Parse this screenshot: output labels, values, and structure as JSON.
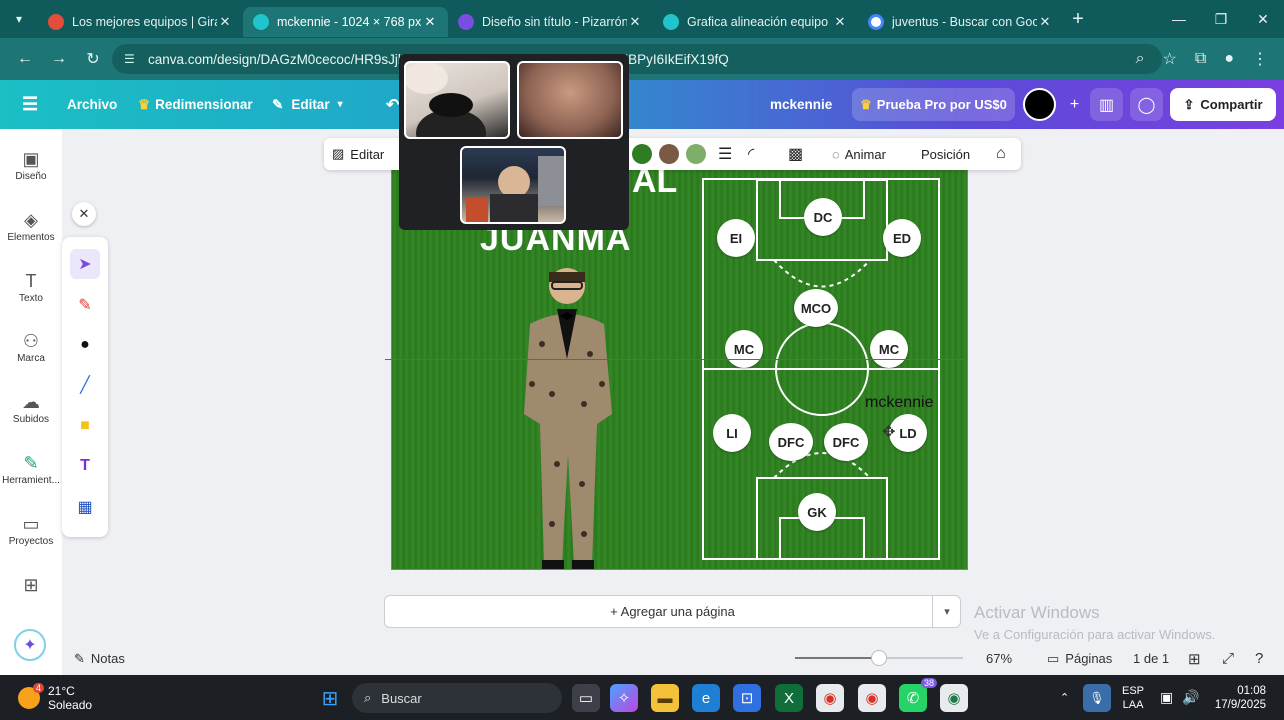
{
  "browser": {
    "tabs": [
      {
        "title": "Los mejores equipos | Gira la",
        "color": "#e44d3a"
      },
      {
        "title": "mckennie - 1024 × 768 px",
        "color": "#20c4cb"
      },
      {
        "title": "Diseño sin título - Pizarrón",
        "color": "#7a4ce0"
      },
      {
        "title": "Grafica alineación equipo de",
        "color": "#20c4cb"
      },
      {
        "title": "juventus - Buscar con Googl",
        "color": "#4285f4"
      }
    ],
    "new_tab": "+",
    "url": "canva.com/design/DAGzM0cecoc/HR9sJjlZo…nsiRCl6eyJBPyI6IkEifSwiQiI6eyJBPyI6IkEifX19fQ"
  },
  "canva_header": {
    "menu": [
      "Archivo",
      "Redimensionar",
      "Editar"
    ],
    "doc_name": "mckennie",
    "pro_button": "Prueba Pro por US$0",
    "share": "Compartir"
  },
  "sidenav": {
    "items": [
      {
        "label": "Diseño",
        "icon": "layout-icon"
      },
      {
        "label": "Elementos",
        "icon": "shapes-icon"
      },
      {
        "label": "Texto",
        "icon": "text-icon"
      },
      {
        "label": "Marca",
        "icon": "brand-icon"
      },
      {
        "label": "Subidos",
        "icon": "upload-icon"
      },
      {
        "label": "Herramient...",
        "icon": "tools-icon"
      },
      {
        "label": "Proyectos",
        "icon": "folder-icon"
      }
    ]
  },
  "element_toolbar": {
    "edit": "Editar",
    "animate": "Animar",
    "position": "Posición",
    "swatches": [
      "#2f7d22",
      "#7a5a45",
      "#7fae6a"
    ]
  },
  "design": {
    "title_line1": "AL",
    "title_line2": "JUANMA",
    "floating_text": "mckennie",
    "positions": [
      "DC",
      "EI",
      "ED",
      "MCO",
      "MC",
      "MC",
      "LI",
      "DFC",
      "DFC",
      "LD",
      "GK"
    ]
  },
  "add_page": "+ Agregar una página",
  "activate_windows": {
    "title": "Activar Windows",
    "subtitle": "Ve a Configuración para activar Windows."
  },
  "bottom_bar": {
    "notes": "Notas",
    "zoom": "67%",
    "zoom_fraction": 0.5,
    "pages_label": "Páginas",
    "page_counter": "1 de 1"
  },
  "taskbar": {
    "weather_temp": "21°C",
    "weather_desc": "Soleado",
    "weather_badge": "4",
    "search": "Buscar",
    "lang1": "ESP",
    "lang2": "LAA",
    "time": "01:08",
    "date": "17/9/2025",
    "whatsapp_badge": "38"
  }
}
